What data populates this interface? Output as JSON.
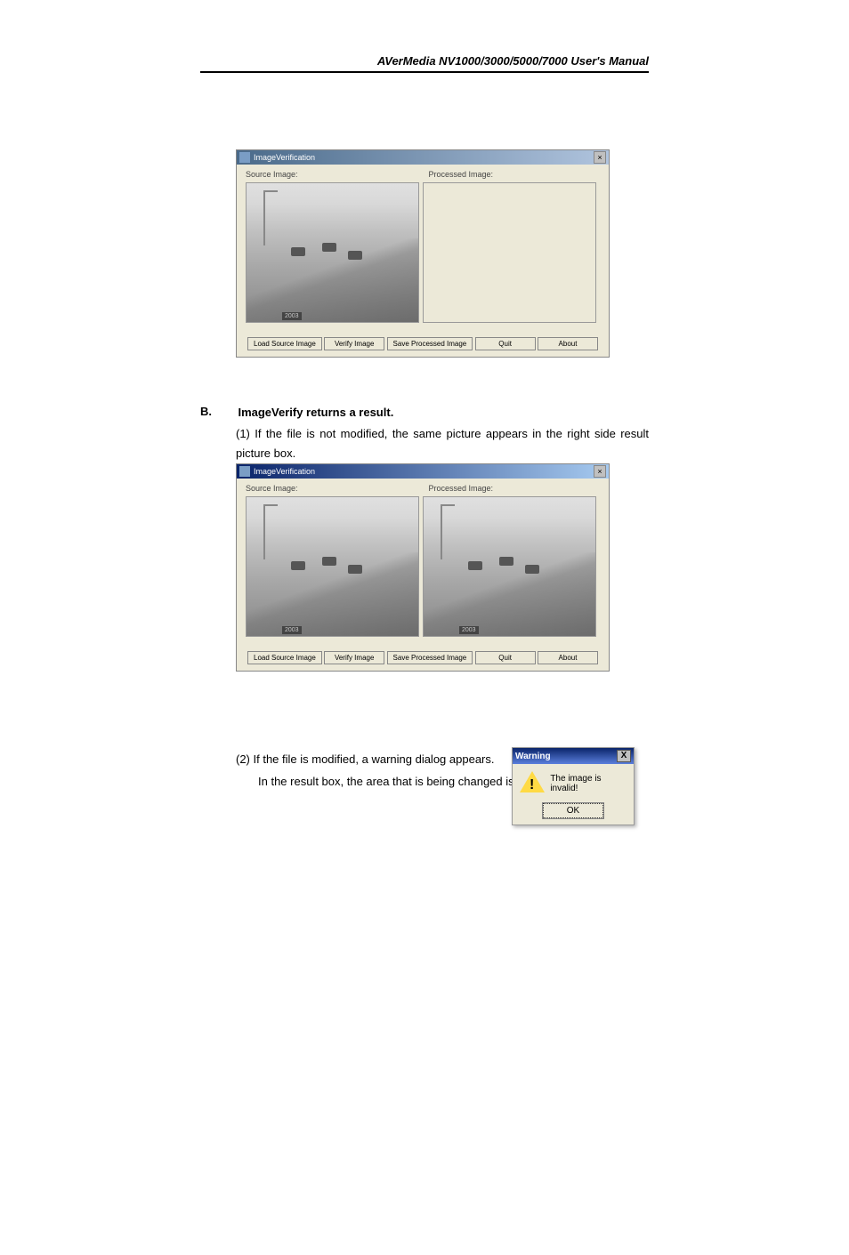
{
  "header": {
    "title": "AVerMedia NV1000/3000/5000/7000 User's Manual"
  },
  "screenshot1": {
    "titlebar": "ImageVerification",
    "source_label": "Source Image:",
    "processed_label": "Processed Image:",
    "timestamp": "2003",
    "buttons": {
      "load": "Load Source Image",
      "verify": "Verify Image",
      "save": "Save Processed Image",
      "quit": "Quit",
      "about": "About"
    }
  },
  "section_b": {
    "letter": "B.",
    "title": "ImageVerify returns a result.",
    "text": "(1) If the file is not modified, the same picture appears in the right side result picture box."
  },
  "screenshot2": {
    "titlebar": "ImageVerification",
    "source_label": "Source Image:",
    "processed_label": "Processed Image:",
    "timestamp1": "2003",
    "timestamp2": "2003",
    "buttons": {
      "load": "Load Source Image",
      "verify": "Verify Image",
      "save": "Save Processed Image",
      "quit": "Quit",
      "about": "About"
    }
  },
  "section_2": {
    "line1": "(2) If the file is modified, a warning dialog appears.",
    "line2": "In the result box, the area that is being changed is highlighted."
  },
  "warning_dialog": {
    "title": "Warning",
    "close": "X",
    "exclaim": "!",
    "message": "The image is invalid!",
    "ok": "OK"
  }
}
